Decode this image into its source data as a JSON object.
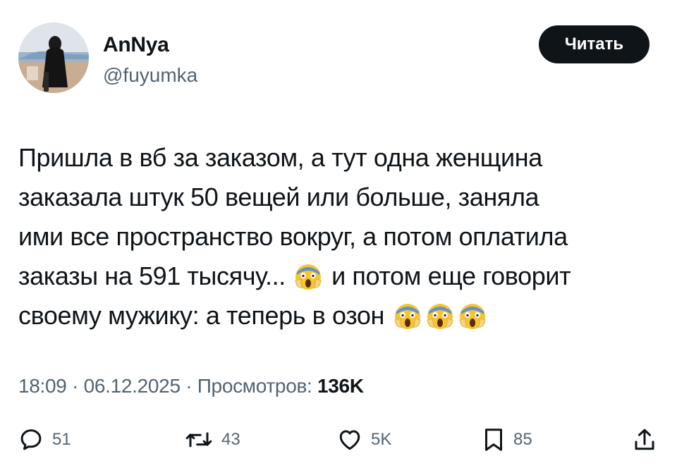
{
  "user": {
    "display_name": "AnNya",
    "handle": "@fuyumka"
  },
  "follow_button": {
    "label": "Читать"
  },
  "tweet": {
    "line1": "Пришла в вб за заказом, а тут одна женщина",
    "line2": "заказала штук 50 вещей или больше, заняла",
    "line3": "ими все пространство вокруг, а потом оплатила",
    "line4a": "заказы на 591 тысячу...",
    "line4b": "и потом еще говорит",
    "line5": "своему мужику: а теперь в озон",
    "emoji": "scream-emoji"
  },
  "meta": {
    "time": "18:09",
    "separator": "·",
    "date": "06.12.2025",
    "views_label": "Просмотров:",
    "views_count": "136K"
  },
  "actions": {
    "reply_count": "51",
    "repost_count": "43",
    "like_count": "5K",
    "bookmark_count": "85"
  },
  "colors": {
    "text": "#0f1419",
    "secondary": "#536471",
    "button_bg": "#0f1419",
    "button_text": "#ffffff"
  },
  "icons": [
    "reply-icon",
    "repost-icon",
    "like-icon",
    "bookmark-icon",
    "share-icon"
  ]
}
